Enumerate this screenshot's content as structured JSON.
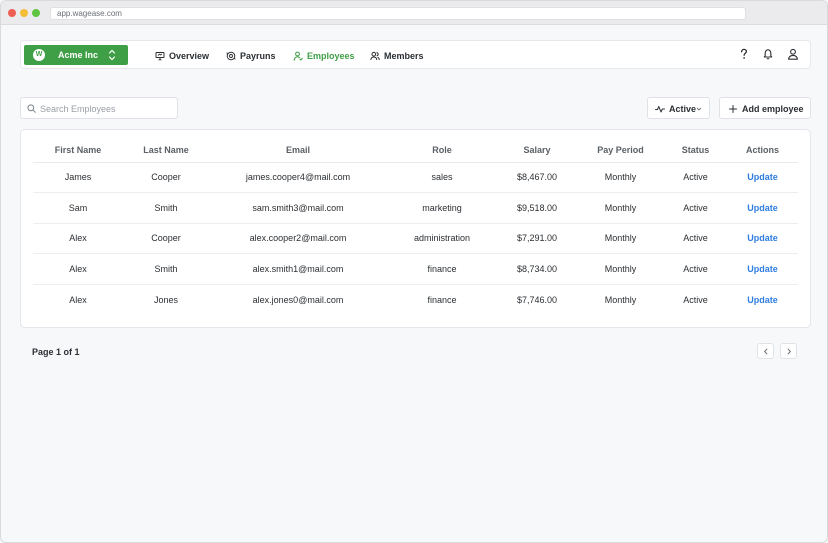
{
  "browser": {
    "url": "app.wagease.com"
  },
  "org": {
    "logo_letter": "W",
    "name": "Acme Inc"
  },
  "nav": {
    "items": [
      {
        "label": "Overview",
        "icon": "presentation-icon"
      },
      {
        "label": "Payruns",
        "icon": "payruns-icon"
      },
      {
        "label": "Employees",
        "icon": "employee-icon",
        "active": true
      },
      {
        "label": "Members",
        "icon": "members-icon"
      }
    ]
  },
  "colors": {
    "brand_green": "#3f9f46",
    "link_blue": "#2f7de1"
  },
  "toolbar": {
    "search_placeholder": "Search Employees",
    "search_value": "",
    "status_filter_label": "Active",
    "add_label": "Add employee"
  },
  "table": {
    "columns": [
      "First Name",
      "Last Name",
      "Email",
      "Role",
      "Salary",
      "Pay Period",
      "Status",
      "Actions"
    ],
    "rows": [
      {
        "first": "James",
        "last": "Cooper",
        "email": "james.cooper4@mail.com",
        "role": "sales",
        "salary": "$8,467.00",
        "period": "Monthly",
        "status": "Active",
        "action": "Update"
      },
      {
        "first": "Sam",
        "last": "Smith",
        "email": "sam.smith3@mail.com",
        "role": "marketing",
        "salary": "$9,518.00",
        "period": "Monthly",
        "status": "Active",
        "action": "Update"
      },
      {
        "first": "Alex",
        "last": "Cooper",
        "email": "alex.cooper2@mail.com",
        "role": "administration",
        "salary": "$7,291.00",
        "period": "Monthly",
        "status": "Active",
        "action": "Update"
      },
      {
        "first": "Alex",
        "last": "Smith",
        "email": "alex.smith1@mail.com",
        "role": "finance",
        "salary": "$8,734.00",
        "period": "Monthly",
        "status": "Active",
        "action": "Update"
      },
      {
        "first": "Alex",
        "last": "Jones",
        "email": "alex.jones0@mail.com",
        "role": "finance",
        "salary": "$7,746.00",
        "period": "Monthly",
        "status": "Active",
        "action": "Update"
      }
    ]
  },
  "pagination": {
    "label": "Page 1 of 1"
  }
}
